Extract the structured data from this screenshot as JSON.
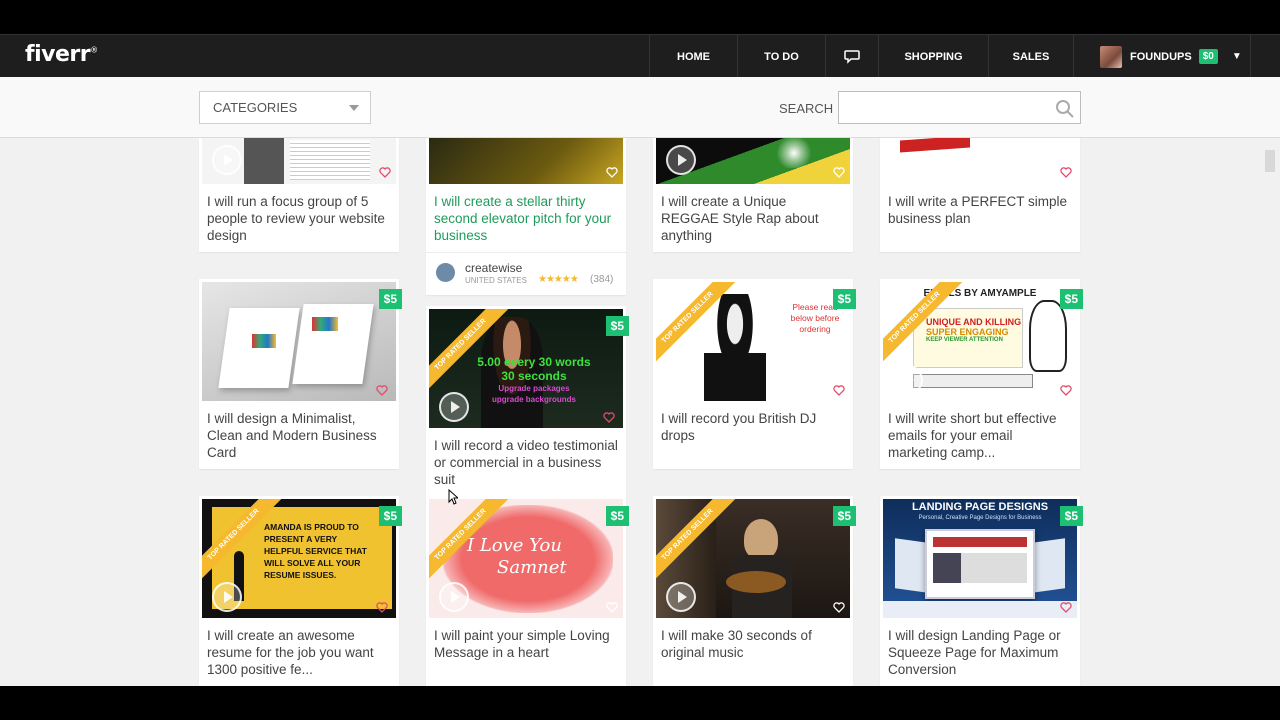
{
  "app": {
    "logo": "fiverr",
    "logo_mark": "®"
  },
  "nav": {
    "home": "HOME",
    "todo": "TO DO",
    "chat_icon": "speech-bubble-icon",
    "shopping": "SHOPPING",
    "sales": "SALES",
    "username": "FOUNDUPS",
    "balance": "$0",
    "caret_icon": "triangle-down-icon"
  },
  "toolbar": {
    "categories_label": "CATEGORIES",
    "search_label": "SEARCH",
    "search_value": "",
    "search_placeholder": ""
  },
  "colors": {
    "accent": "#1dbf73",
    "header_bg": "#1e1e1e",
    "ribbon": "#f5b82e",
    "active_title": "#1f9b5b"
  },
  "gigs": [
    {
      "title": "I will run a focus group of 5 people to review your website design",
      "price": "",
      "top_rated": false,
      "video": true
    },
    {
      "title": "I will create a stellar thirty second elevator pitch for your business",
      "price": "",
      "top_rated": false,
      "video": false,
      "seller": {
        "name": "createwise",
        "country": "UNITED STATES",
        "rating": "★★★★★",
        "reviews": "(384)"
      }
    },
    {
      "title": "I will create a Unique REGGAE Style Rap about anything",
      "price": "",
      "top_rated": false,
      "video": true
    },
    {
      "title": "I will write a PERFECT simple business plan",
      "price": "",
      "top_rated": false,
      "video": false
    },
    {
      "title": "I will design a Minimalist, Clean and Modern Business Card",
      "price": "$5",
      "top_rated": false,
      "video": false
    },
    {
      "title": "I will record a video testimonial or commercial in a business suit",
      "price": "$5",
      "top_rated": true,
      "video": true,
      "overlay": [
        "5.00 every 30 words",
        "30 seconds",
        "Upgrade packages",
        "upgrade backgrounds"
      ]
    },
    {
      "title": "I will record you British DJ drops",
      "price": "$5",
      "top_rated": true,
      "video": true,
      "overlay": [
        "Please read",
        "below before",
        "ordering"
      ]
    },
    {
      "title": "I will write short but effective emails for your email marketing camp...",
      "price": "$5",
      "top_rated": true,
      "video": true,
      "overlay": [
        "EMAILS BY AMYAMPLE",
        "UNIQUE AND KILLING",
        "SUPER ENGAGING",
        "KEEP VIEWER ATTENTION"
      ]
    },
    {
      "title": "I will create an awesome resume for the job you want 1300 positive fe...",
      "price": "$5",
      "top_rated": true,
      "video": true,
      "overlay": [
        "AMANDA IS PROUD TO",
        "PRESENT A VERY",
        "HELPFUL SERVICE THAT",
        "WILL SOLVE ALL YOUR",
        "RESUME ISSUES."
      ]
    },
    {
      "title": "I will paint your simple Loving Message in a heart",
      "price": "$5",
      "top_rated": true,
      "video": true,
      "overlay": [
        "I Love You",
        "Samnet"
      ]
    },
    {
      "title": "I will make 30 seconds of original music",
      "price": "$5",
      "top_rated": true,
      "video": true
    },
    {
      "title": "I will design Landing Page or Squeeze Page for Maximum Conversion",
      "price": "$5",
      "top_rated": false,
      "video": false,
      "overlay": [
        "LANDING PAGE DESIGNS",
        "Personal, Creative Page Designs for Business"
      ]
    }
  ],
  "ribbon_text": "TOP RATED SELLER"
}
